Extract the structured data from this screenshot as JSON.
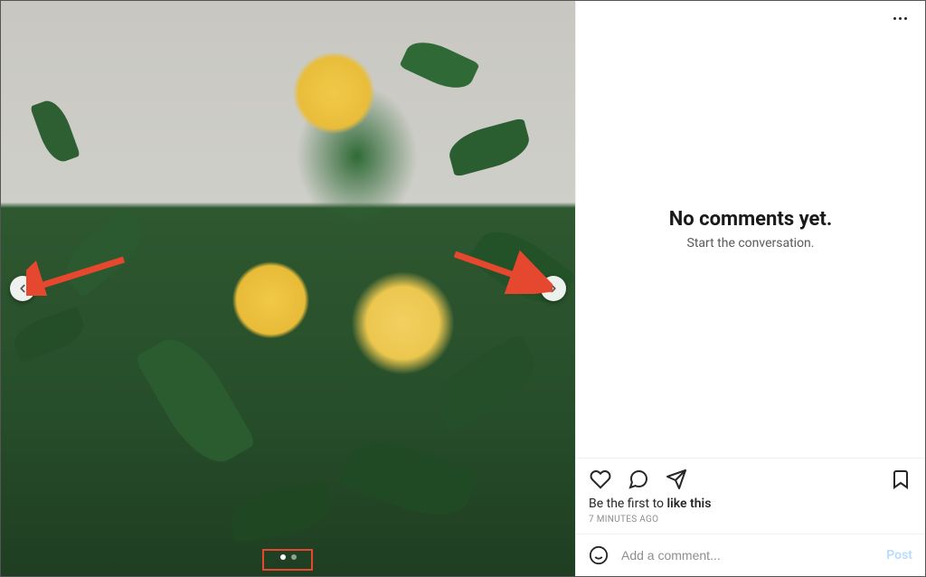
{
  "media": {
    "carousel": {
      "count": 2,
      "active_index": 0
    }
  },
  "panel": {
    "empty_state": {
      "title": "No comments yet.",
      "subtitle": "Start the conversation."
    },
    "likes_prefix": "Be the first to ",
    "likes_action": "like this",
    "timestamp": "7 MINUTES AGO",
    "comment_placeholder": "Add a comment...",
    "post_label": "Post"
  },
  "annotations": {
    "highlight_box": "carousel-dots",
    "arrows": [
      "nav-prev-button",
      "nav-next-button"
    ]
  }
}
